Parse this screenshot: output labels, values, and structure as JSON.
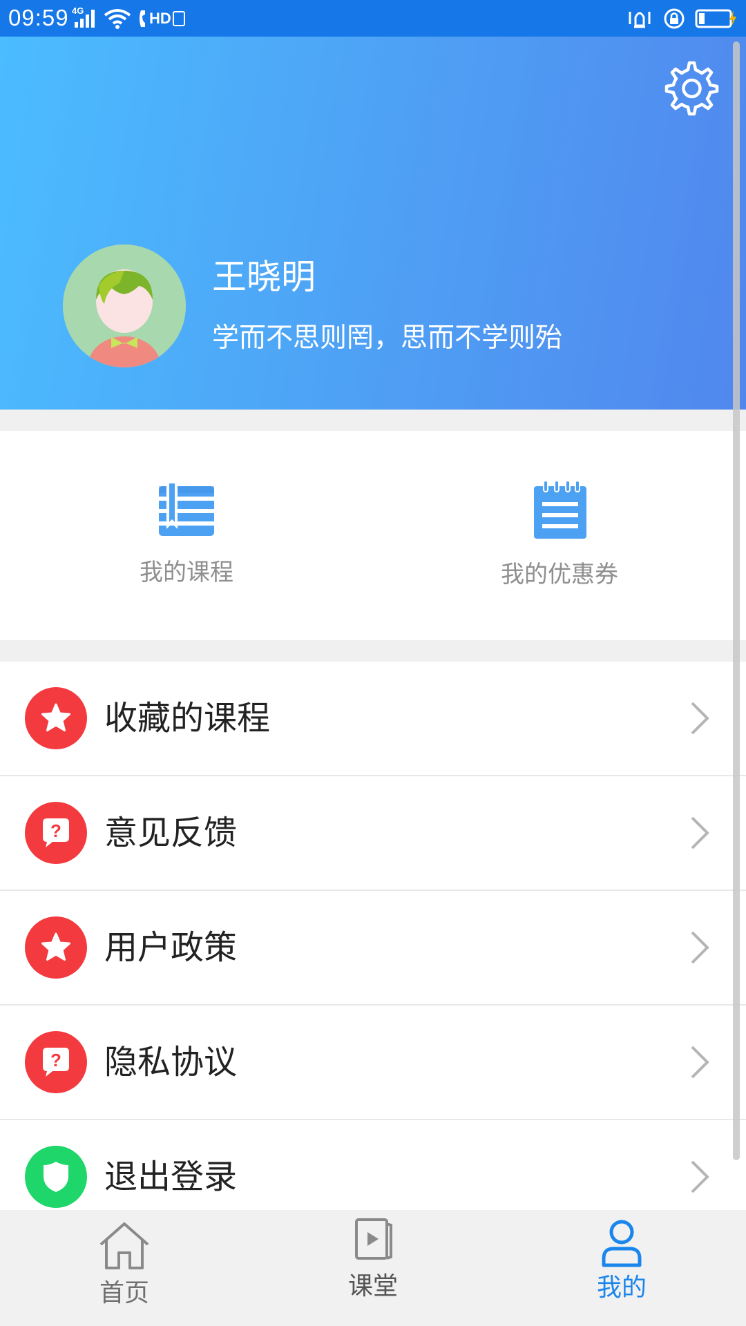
{
  "status_bar": {
    "time": "09:59",
    "network_type": "4G",
    "hd_label": "HD"
  },
  "header": {
    "user_name": "王晓明",
    "motto": "学而不思则罔，思而不学则殆"
  },
  "quick_actions": [
    {
      "label": "我的课程",
      "icon": "book-list-icon"
    },
    {
      "label": "我的优惠券",
      "icon": "notepad-icon"
    }
  ],
  "menu": [
    {
      "label": "收藏的课程",
      "icon": "star-icon",
      "color": "#f23a3f"
    },
    {
      "label": "意见反馈",
      "icon": "question-bubble-icon",
      "color": "#f23a3f"
    },
    {
      "label": "用户政策",
      "icon": "star-icon",
      "color": "#f23a3f"
    },
    {
      "label": "隐私协议",
      "icon": "question-bubble-icon",
      "color": "#f23a3f"
    },
    {
      "label": "退出登录",
      "icon": "shield-icon",
      "color": "#1fd66a"
    }
  ],
  "tabs": [
    {
      "label": "首页",
      "icon": "home-icon",
      "active": false
    },
    {
      "label": "课堂",
      "icon": "video-icon",
      "active": false
    },
    {
      "label": "我的",
      "icon": "user-icon",
      "active": true
    }
  ],
  "colors": {
    "accent": "#1677e8",
    "active_tab": "#1a86ec",
    "inactive_tab": "#6f6f6f",
    "danger_icon": "#f23a3f",
    "logout_icon": "#1fd66a"
  }
}
